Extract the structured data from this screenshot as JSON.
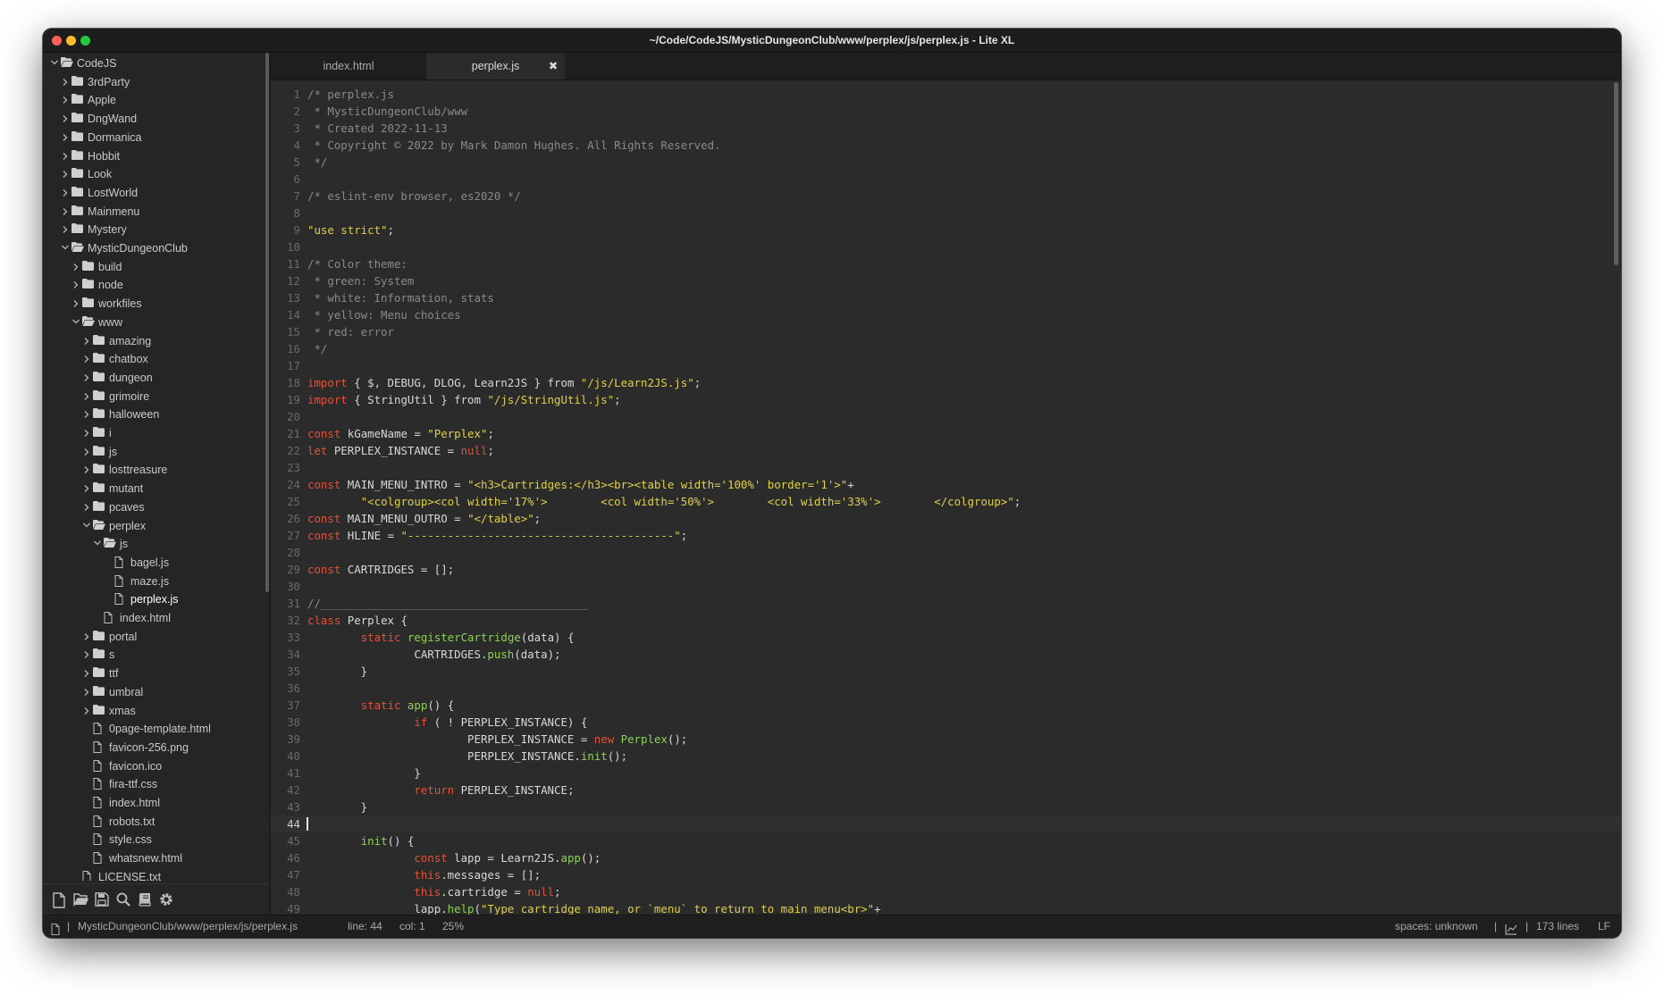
{
  "window": {
    "title": "~/Code/CodeJS/MysticDungeonClub/www/perplex/js/perplex.js - Lite XL"
  },
  "sidebar": {
    "tree": [
      {
        "label": "CodeJS",
        "kind": "folder",
        "depth": 0,
        "open": true
      },
      {
        "label": "3rdParty",
        "kind": "folder",
        "depth": 1,
        "open": false
      },
      {
        "label": "Apple",
        "kind": "folder",
        "depth": 1,
        "open": false
      },
      {
        "label": "DngWand",
        "kind": "folder",
        "depth": 1,
        "open": false
      },
      {
        "label": "Dormanica",
        "kind": "folder",
        "depth": 1,
        "open": false
      },
      {
        "label": "Hobbit",
        "kind": "folder",
        "depth": 1,
        "open": false
      },
      {
        "label": "Look",
        "kind": "folder",
        "depth": 1,
        "open": false
      },
      {
        "label": "LostWorld",
        "kind": "folder",
        "depth": 1,
        "open": false
      },
      {
        "label": "Mainmenu",
        "kind": "folder",
        "depth": 1,
        "open": false
      },
      {
        "label": "Mystery",
        "kind": "folder",
        "depth": 1,
        "open": false
      },
      {
        "label": "MysticDungeonClub",
        "kind": "folder",
        "depth": 1,
        "open": true
      },
      {
        "label": "build",
        "kind": "folder",
        "depth": 2,
        "open": false
      },
      {
        "label": "node",
        "kind": "folder",
        "depth": 2,
        "open": false
      },
      {
        "label": "workfiles",
        "kind": "folder",
        "depth": 2,
        "open": false
      },
      {
        "label": "www",
        "kind": "folder",
        "depth": 2,
        "open": true
      },
      {
        "label": "amazing",
        "kind": "folder",
        "depth": 3,
        "open": false
      },
      {
        "label": "chatbox",
        "kind": "folder",
        "depth": 3,
        "open": false
      },
      {
        "label": "dungeon",
        "kind": "folder",
        "depth": 3,
        "open": false
      },
      {
        "label": "grimoire",
        "kind": "folder",
        "depth": 3,
        "open": false
      },
      {
        "label": "halloween",
        "kind": "folder",
        "depth": 3,
        "open": false
      },
      {
        "label": "i",
        "kind": "folder",
        "depth": 3,
        "open": false
      },
      {
        "label": "js",
        "kind": "folder",
        "depth": 3,
        "open": false
      },
      {
        "label": "losttreasure",
        "kind": "folder",
        "depth": 3,
        "open": false
      },
      {
        "label": "mutant",
        "kind": "folder",
        "depth": 3,
        "open": false
      },
      {
        "label": "pcaves",
        "kind": "folder",
        "depth": 3,
        "open": false
      },
      {
        "label": "perplex",
        "kind": "folder",
        "depth": 3,
        "open": true
      },
      {
        "label": "js",
        "kind": "folder",
        "depth": 4,
        "open": true
      },
      {
        "label": "bagel.js",
        "kind": "file",
        "depth": 5
      },
      {
        "label": "maze.js",
        "kind": "file",
        "depth": 5
      },
      {
        "label": "perplex.js",
        "kind": "file",
        "depth": 5,
        "active": true
      },
      {
        "label": "index.html",
        "kind": "file",
        "depth": 4
      },
      {
        "label": "portal",
        "kind": "folder",
        "depth": 3,
        "open": false
      },
      {
        "label": "s",
        "kind": "folder",
        "depth": 3,
        "open": false
      },
      {
        "label": "ttf",
        "kind": "folder",
        "depth": 3,
        "open": false
      },
      {
        "label": "umbral",
        "kind": "folder",
        "depth": 3,
        "open": false
      },
      {
        "label": "xmas",
        "kind": "folder",
        "depth": 3,
        "open": false
      },
      {
        "label": "0page-template.html",
        "kind": "file",
        "depth": 3
      },
      {
        "label": "favicon-256.png",
        "kind": "file",
        "depth": 3
      },
      {
        "label": "favicon.ico",
        "kind": "file",
        "depth": 3
      },
      {
        "label": "fira-ttf.css",
        "kind": "file",
        "depth": 3
      },
      {
        "label": "index.html",
        "kind": "file",
        "depth": 3
      },
      {
        "label": "robots.txt",
        "kind": "file",
        "depth": 3
      },
      {
        "label": "style.css",
        "kind": "file",
        "depth": 3
      },
      {
        "label": "whatsnew.html",
        "kind": "file",
        "depth": 3
      },
      {
        "label": "LICENSE.txt",
        "kind": "file",
        "depth": 2
      }
    ],
    "toolbar": [
      {
        "icon": "new-file-icon",
        "name": "new-file-button"
      },
      {
        "icon": "open-folder-icon",
        "name": "open-folder-button"
      },
      {
        "icon": "save-icon",
        "name": "save-button"
      },
      {
        "icon": "search-icon",
        "name": "find-button"
      },
      {
        "icon": "book-icon",
        "name": "command-palette-button"
      },
      {
        "icon": "gear-icon",
        "name": "settings-button"
      }
    ]
  },
  "tabs": [
    {
      "label": "index.html",
      "active": false
    },
    {
      "label": "perplex.js",
      "active": true,
      "close": "✖"
    }
  ],
  "editor": {
    "current_line": 44,
    "colors": {
      "comment": "#8a8a8a",
      "keyword": "#e0533a",
      "string": "#dfd04a",
      "function": "#8cd354",
      "text": "#d8d8d8"
    },
    "lines": [
      [
        [
          "cm",
          "/* perplex.js"
        ]
      ],
      [
        [
          "cm",
          " * MysticDungeonClub/www"
        ]
      ],
      [
        [
          "cm",
          " * Created 2022-11-13"
        ]
      ],
      [
        [
          "cm",
          " * Copyright © 2022 by Mark Damon Hughes. All Rights Reserved."
        ]
      ],
      [
        [
          "cm",
          " */"
        ]
      ],
      [],
      [
        [
          "cm",
          "/* eslint-env browser, es2020 */"
        ]
      ],
      [],
      [
        [
          "st",
          "\"use strict\""
        ],
        [
          "tx",
          ";"
        ]
      ],
      [],
      [
        [
          "cm",
          "/* Color theme:"
        ]
      ],
      [
        [
          "cm",
          " * green: System"
        ]
      ],
      [
        [
          "cm",
          " * white: Information, stats"
        ]
      ],
      [
        [
          "cm",
          " * yellow: Menu choices"
        ]
      ],
      [
        [
          "cm",
          " * red: error"
        ]
      ],
      [
        [
          "cm",
          " */"
        ]
      ],
      [],
      [
        [
          "kw",
          "import"
        ],
        [
          "tx",
          " { $, DEBUG, DLOG, Learn2JS } from "
        ],
        [
          "st",
          "\"/js/Learn2JS.js\""
        ],
        [
          "tx",
          ";"
        ]
      ],
      [
        [
          "kw",
          "import"
        ],
        [
          "tx",
          " { StringUtil } from "
        ],
        [
          "st",
          "\"/js/StringUtil.js\""
        ],
        [
          "tx",
          ";"
        ]
      ],
      [],
      [
        [
          "kw",
          "const"
        ],
        [
          "tx",
          " kGameName = "
        ],
        [
          "st",
          "\"Perplex\""
        ],
        [
          "tx",
          ";"
        ]
      ],
      [
        [
          "kw",
          "let"
        ],
        [
          "tx",
          " PERPLEX_INSTANCE = "
        ],
        [
          "lt",
          "null"
        ],
        [
          "tx",
          ";"
        ]
      ],
      [],
      [
        [
          "kw",
          "const"
        ],
        [
          "tx",
          " MAIN_MENU_INTRO = "
        ],
        [
          "st",
          "\"<h3>Cartridges:</h3><br><table width='100%' border='1'>\""
        ],
        [
          "tx",
          "+"
        ]
      ],
      [
        [
          "tx",
          "        "
        ],
        [
          "st",
          "\"<colgroup><col width='17%'>        <col width='50%'>        <col width='33%'>        </colgroup>\""
        ],
        [
          "tx",
          ";"
        ]
      ],
      [
        [
          "kw",
          "const"
        ],
        [
          "tx",
          " MAIN_MENU_OUTRO = "
        ],
        [
          "st",
          "\"</table>\""
        ],
        [
          "tx",
          ";"
        ]
      ],
      [
        [
          "kw",
          "const"
        ],
        [
          "tx",
          " HLINE = "
        ],
        [
          "st",
          "\"----------------------------------------\""
        ],
        [
          "tx",
          ";"
        ]
      ],
      [],
      [
        [
          "kw",
          "const"
        ],
        [
          "tx",
          " CARTRIDGES = [];"
        ]
      ],
      [],
      [
        [
          "cm",
          "//________________________________________"
        ]
      ],
      [
        [
          "kw",
          "class"
        ],
        [
          "tx",
          " Perplex {"
        ]
      ],
      [
        [
          "tx",
          "        "
        ],
        [
          "kw",
          "static"
        ],
        [
          "tx",
          " "
        ],
        [
          "fn",
          "registerCartridge"
        ],
        [
          "tx",
          "(data) {"
        ]
      ],
      [
        [
          "tx",
          "                CARTRIDGES."
        ],
        [
          "fn",
          "push"
        ],
        [
          "tx",
          "(data);"
        ]
      ],
      [
        [
          "tx",
          "        }"
        ]
      ],
      [],
      [
        [
          "tx",
          "        "
        ],
        [
          "kw",
          "static"
        ],
        [
          "tx",
          " "
        ],
        [
          "fn",
          "app"
        ],
        [
          "tx",
          "() {"
        ]
      ],
      [
        [
          "tx",
          "                "
        ],
        [
          "kw",
          "if"
        ],
        [
          "tx",
          " ( ! PERPLEX_INSTANCE) {"
        ]
      ],
      [
        [
          "tx",
          "                        PERPLEX_INSTANCE = "
        ],
        [
          "kw",
          "new"
        ],
        [
          "tx",
          " "
        ],
        [
          "fn",
          "Perplex"
        ],
        [
          "tx",
          "();"
        ]
      ],
      [
        [
          "tx",
          "                        PERPLEX_INSTANCE."
        ],
        [
          "fn",
          "init"
        ],
        [
          "tx",
          "();"
        ]
      ],
      [
        [
          "tx",
          "                }"
        ]
      ],
      [
        [
          "tx",
          "                "
        ],
        [
          "kw",
          "return"
        ],
        [
          "tx",
          " PERPLEX_INSTANCE;"
        ]
      ],
      [
        [
          "tx",
          "        }"
        ]
      ],
      [],
      [
        [
          "tx",
          "        "
        ],
        [
          "fn",
          "init"
        ],
        [
          "tx",
          "() {"
        ]
      ],
      [
        [
          "tx",
          "                "
        ],
        [
          "kw",
          "const"
        ],
        [
          "tx",
          " lapp = Learn2JS."
        ],
        [
          "fn",
          "app"
        ],
        [
          "tx",
          "();"
        ]
      ],
      [
        [
          "tx",
          "                "
        ],
        [
          "kw",
          "this"
        ],
        [
          "tx",
          ".messages = [];"
        ]
      ],
      [
        [
          "tx",
          "                "
        ],
        [
          "kw",
          "this"
        ],
        [
          "tx",
          ".cartridge = "
        ],
        [
          "lt",
          "null"
        ],
        [
          "tx",
          ";"
        ]
      ],
      [
        [
          "tx",
          "                lapp."
        ],
        [
          "fn",
          "help"
        ],
        [
          "tx",
          "("
        ],
        [
          "st",
          "\"Type cartridge name, or `menu` to return to main menu<br>\""
        ],
        [
          "tx",
          "+"
        ]
      ]
    ]
  },
  "status": {
    "file_icon": "file-icon",
    "sep": "|",
    "path": "MysticDungeonClub/www/perplex/js/perplex.js",
    "line": "line: 44",
    "col": "col: 1",
    "percent": "25%",
    "spaces": "spaces: unknown",
    "chart_icon": "line-chart-icon",
    "lines": "173 lines",
    "eol": "LF"
  }
}
